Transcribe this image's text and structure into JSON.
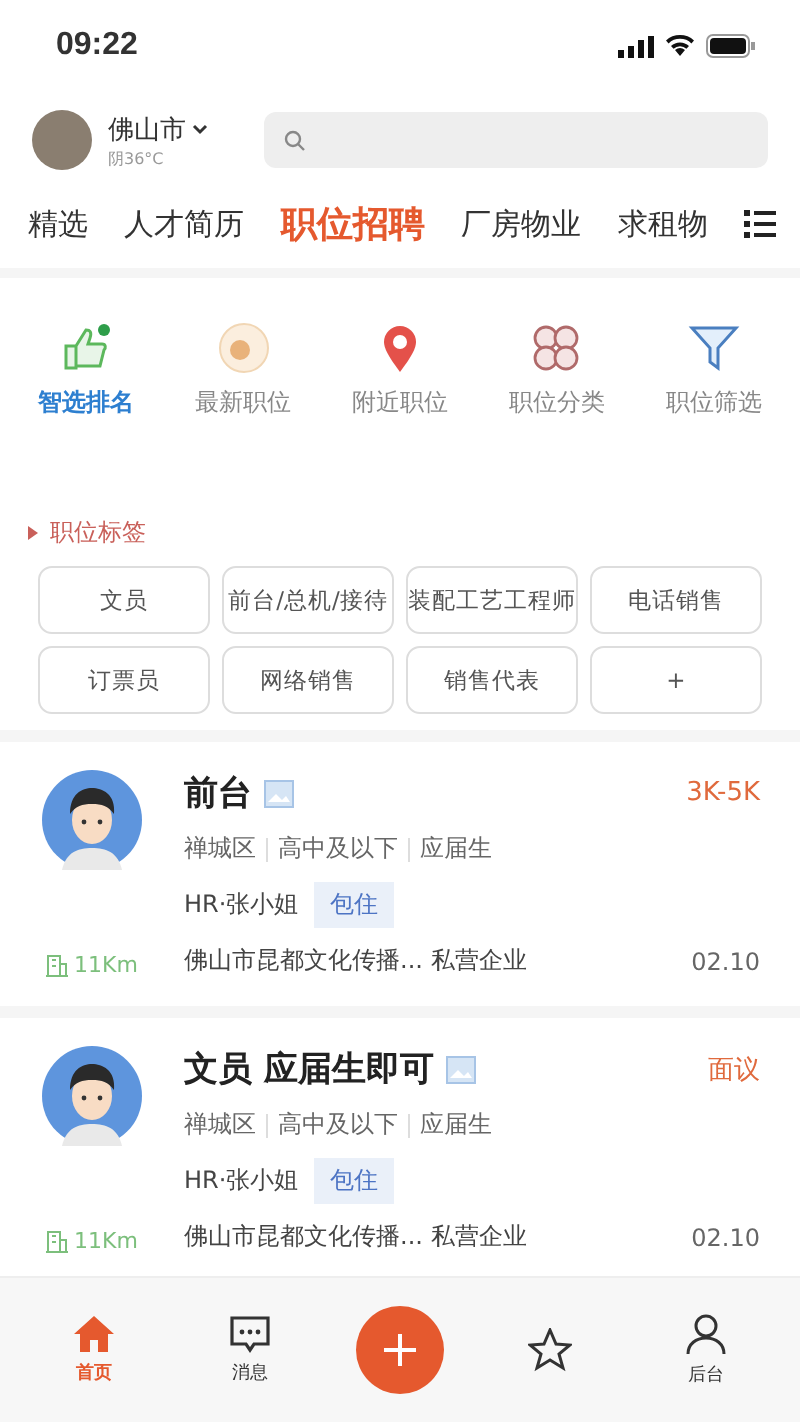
{
  "status_bar": {
    "time": "09:22"
  },
  "header": {
    "city": "佛山市",
    "weather": "阴36°C"
  },
  "tabs": [
    {
      "label": "精选",
      "selected": false
    },
    {
      "label": "人才简历",
      "selected": false
    },
    {
      "label": "职位招聘",
      "selected": true
    },
    {
      "label": "厂房物业",
      "selected": false
    },
    {
      "label": "求租物",
      "selected": false
    }
  ],
  "quick_links": [
    {
      "label": "智选排名",
      "kind": "thumb",
      "selected": true
    },
    {
      "label": "最新职位",
      "kind": "new",
      "selected": false
    },
    {
      "label": "附近职位",
      "kind": "pin",
      "selected": false
    },
    {
      "label": "职位分类",
      "kind": "grid",
      "selected": false
    },
    {
      "label": "职位筛选",
      "kind": "filter",
      "selected": false
    }
  ],
  "tags_section": {
    "title": "职位标签",
    "tags": [
      "文员",
      "前台/总机/接待",
      "装配工艺工程师",
      "电话销售",
      "订票员",
      "网络销售",
      "销售代表",
      "+"
    ]
  },
  "jobs": [
    {
      "title": "前台",
      "salary": "3K-5K",
      "details": [
        "禅城区",
        "高中及以下",
        "应届生"
      ],
      "hr": "HR·张小姐",
      "badge": "包住",
      "distance": "11Km",
      "company": "佛山市昆都文化传播... 私营企业",
      "date": "02.10"
    },
    {
      "title": "文员 应届生即可",
      "salary": "面议",
      "details": [
        "禅城区",
        "高中及以下",
        "应届生"
      ],
      "hr": "HR·张小姐",
      "badge": "包住",
      "distance": "11Km",
      "company": "佛山市昆都文化传播... 私营企业",
      "date": "02.10"
    }
  ],
  "bottom_nav": [
    {
      "label": "首页",
      "kind": "home",
      "selected": true
    },
    {
      "label": "消息",
      "kind": "message",
      "selected": false
    },
    {
      "kind": "add"
    },
    {
      "kind": "star",
      "selected": false
    },
    {
      "label": "后台",
      "kind": "person",
      "selected": false
    }
  ]
}
